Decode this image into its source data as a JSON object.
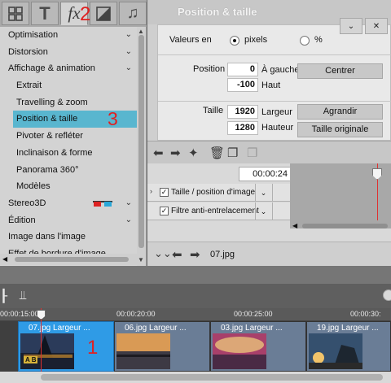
{
  "tabs": {
    "text_tab": "T",
    "effects_tab": "fx"
  },
  "annotations": {
    "n2": "2",
    "n3": "3",
    "n1": "1"
  },
  "menu": {
    "items": [
      {
        "label": "Optimisation",
        "chevron": "⌄"
      },
      {
        "label": "Distorsion",
        "chevron": "⌄"
      },
      {
        "label": "Affichage & animation",
        "chevron": "⌄"
      },
      {
        "label": "Extrait"
      },
      {
        "label": "Travelling & zoom"
      },
      {
        "label": "Position & taille"
      },
      {
        "label": "Pivoter & refléter"
      },
      {
        "label": "Inclinaison & forme"
      },
      {
        "label": "Panorama 360°"
      },
      {
        "label": "Modèles"
      },
      {
        "label": "Stereo3D",
        "chevron": "⌄"
      },
      {
        "label": "Édition",
        "chevron": "⌄"
      },
      {
        "label": "Image dans l'image"
      },
      {
        "label": "Effet de bordure d'image"
      }
    ]
  },
  "panel": {
    "title": "Position & taille",
    "values_in_label": "Valeurs en",
    "unit_pixels": "pixels",
    "unit_percent": "%",
    "position_label": "Position",
    "position_x": "0",
    "position_x_label": "À gauche",
    "position_y": "-100",
    "position_y_label": "Haut",
    "center_button": "Centrer",
    "size_label": "Taille",
    "width": "1920",
    "width_label": "Largeur",
    "height": "1280",
    "height_label": "Hauteur",
    "enlarge_button": "Agrandir",
    "original_size_button": "Taille originale",
    "collapse_btn": "⌄",
    "close_btn": "✕"
  },
  "keyframes": {
    "timecode": "00:00:24",
    "rows": [
      {
        "label": "Taille / position d'image",
        "checked": "✓"
      },
      {
        "label": "Filtre anti-entrelacement",
        "checked": "✓"
      }
    ]
  },
  "nav": {
    "file": "07.jpg"
  },
  "timeline": {
    "ruler": [
      "00:00:15:00",
      "00:00:20:00",
      "00:00:25:00",
      "00:00:30:"
    ],
    "clips": [
      {
        "name": "07.jpg   Largeur ..."
      },
      {
        "name": "06.jpg   Largeur ..."
      },
      {
        "name": "03.jpg   Largeur ..."
      },
      {
        "name": "19.jpg   Largeur ..."
      }
    ],
    "ab_badge": "A B"
  }
}
